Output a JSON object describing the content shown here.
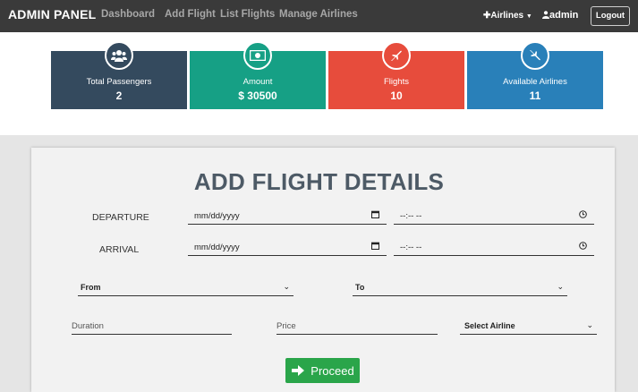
{
  "navbar": {
    "brand": "ADMIN PANEL",
    "links": [
      "Dashboard",
      "Add Flight",
      "List Flights",
      "Manage Airlines"
    ],
    "airlines_menu": "Airlines",
    "user": "admin",
    "logout": "Logout"
  },
  "stats": [
    {
      "title": "Total Passengers",
      "value": "2",
      "color": "#344a5e",
      "icon": "users-icon"
    },
    {
      "title": "Amount",
      "value": "$ 30500",
      "color": "#16a085",
      "icon": "money-icon"
    },
    {
      "title": "Flights",
      "value": "10",
      "color": "#e74c3c",
      "icon": "plane-icon"
    },
    {
      "title": "Available Airlines",
      "value": "11",
      "color": "#2980b9",
      "icon": "plane-icon"
    }
  ],
  "form": {
    "title": "ADD FLIGHT DETAILS",
    "departure_label": "DEPARTURE",
    "arrival_label": "ARRIVAL",
    "date_placeholder": "mm/dd/yyyy",
    "time_placeholder": "--:-- --",
    "from": "From",
    "to": "To",
    "duration": "Duration",
    "price": "Price",
    "airline": "Select Airline",
    "proceed": "Proceed"
  }
}
